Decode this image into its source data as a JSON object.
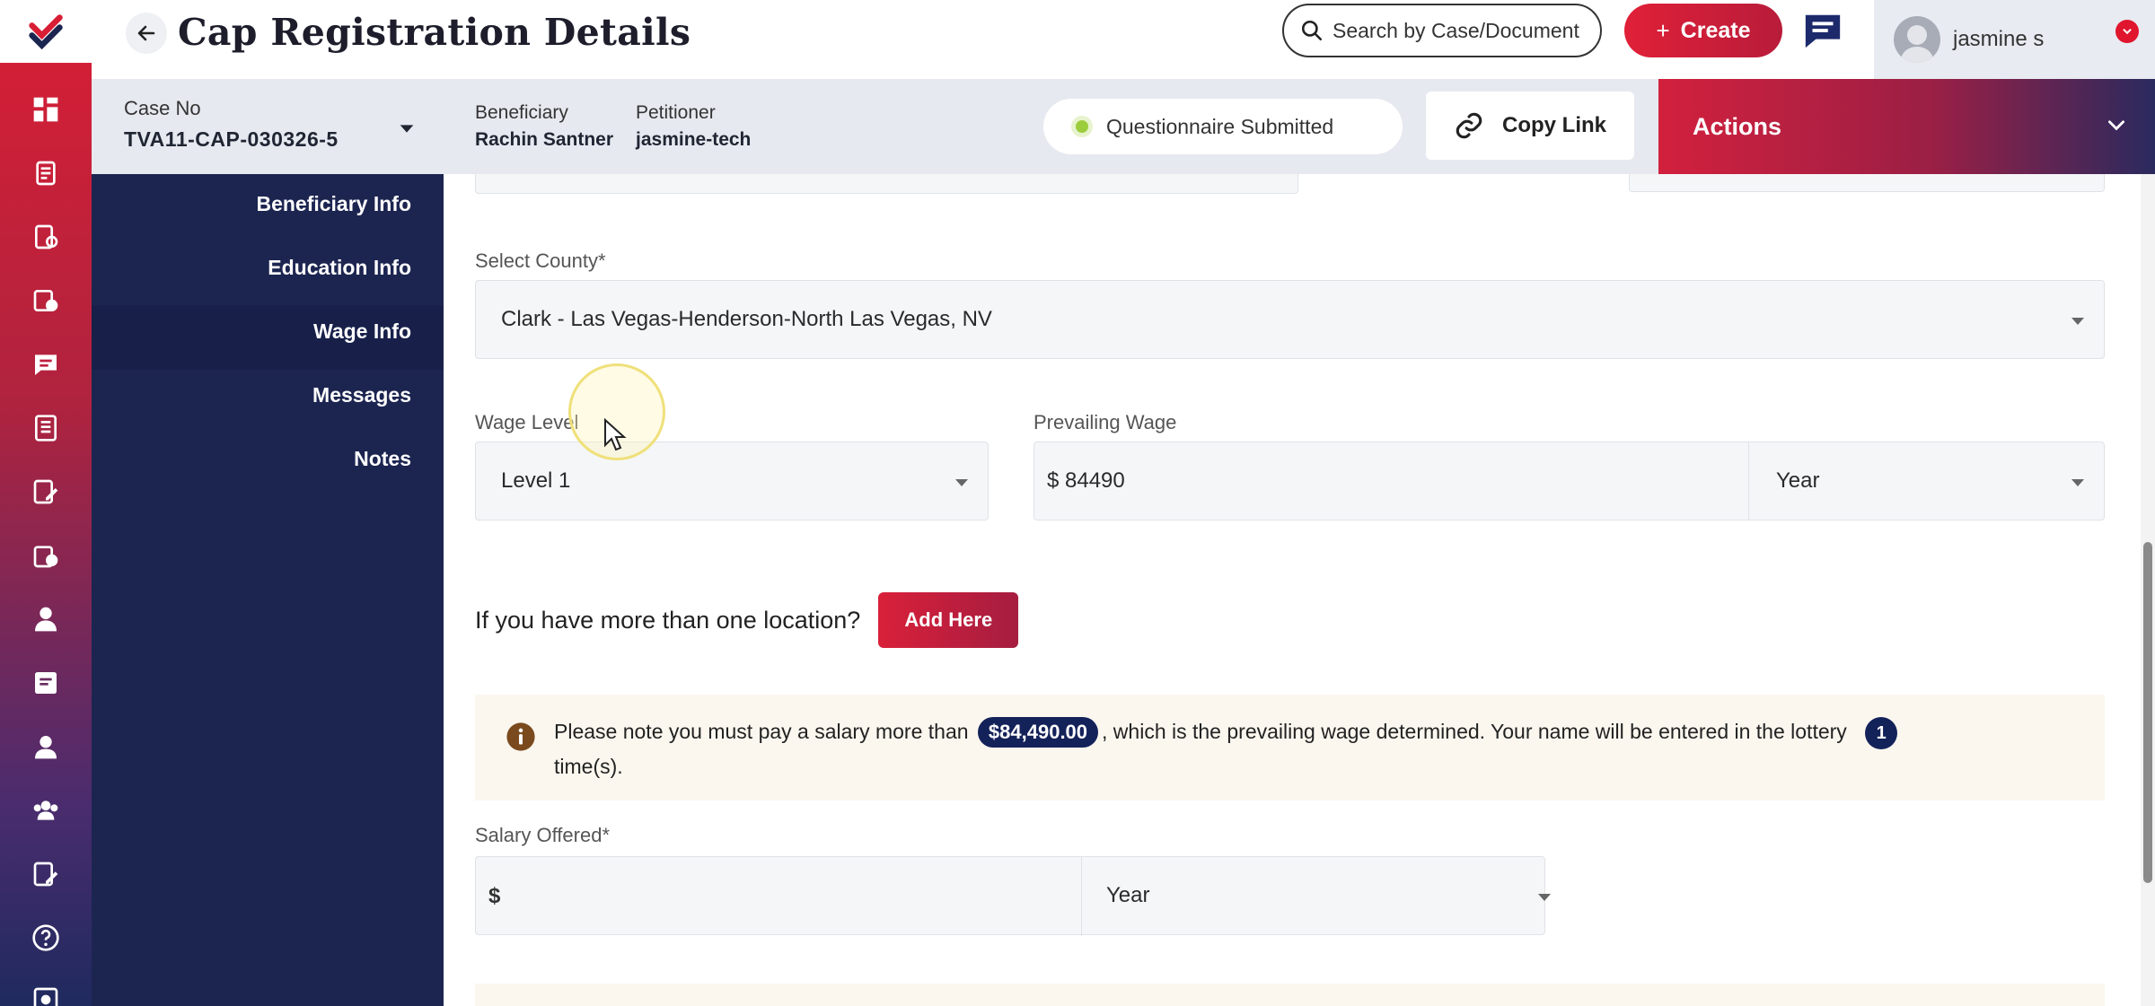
{
  "header": {
    "title": "Cap Registration Details",
    "search_placeholder": "Search by Case/Document",
    "create_label": "Create",
    "user_name": "jasmine s"
  },
  "case_bar": {
    "case_no_label": "Case No",
    "case_no_value": "TVA11-CAP-030326-5",
    "beneficiary_label": "Beneficiary",
    "beneficiary_value": "Rachin Santner",
    "petitioner_label": "Petitioner",
    "petitioner_value": "jasmine-tech",
    "status_label": "Questionnaire Submitted",
    "copy_link_label": "Copy Link",
    "actions_label": "Actions"
  },
  "section_nav": {
    "items": [
      {
        "label": "Beneficiary Info"
      },
      {
        "label": "Education Info"
      },
      {
        "label": "Wage Info"
      },
      {
        "label": "Messages"
      },
      {
        "label": "Notes"
      }
    ],
    "active": "Wage Info"
  },
  "form": {
    "county_label": "Select County*",
    "county_value": "Clark - Las Vegas-Henderson-North Las Vegas, NV",
    "wage_level_label": "Wage Level",
    "wage_level_value": "Level 1",
    "prevailing_wage_label": "Prevailing Wage",
    "prevailing_wage_value": "$ 84490",
    "prevailing_wage_unit": "Year",
    "location_question": "If you have more than one location?",
    "add_here_label": "Add Here",
    "notice_prefix": "Please note you must pay a salary more than",
    "notice_amount": "$84,490.00",
    "notice_middle": ", which is the prevailing wage determined. Your name will be entered in the lottery",
    "notice_count": "1",
    "notice_suffix": "time(s).",
    "salary_label": "Salary Offered*",
    "salary_currency": "$",
    "salary_unit": "Year"
  },
  "colors": {
    "brand_red": "#d81e35",
    "navy": "#1c2550",
    "status_green": "#9ccd3c"
  }
}
